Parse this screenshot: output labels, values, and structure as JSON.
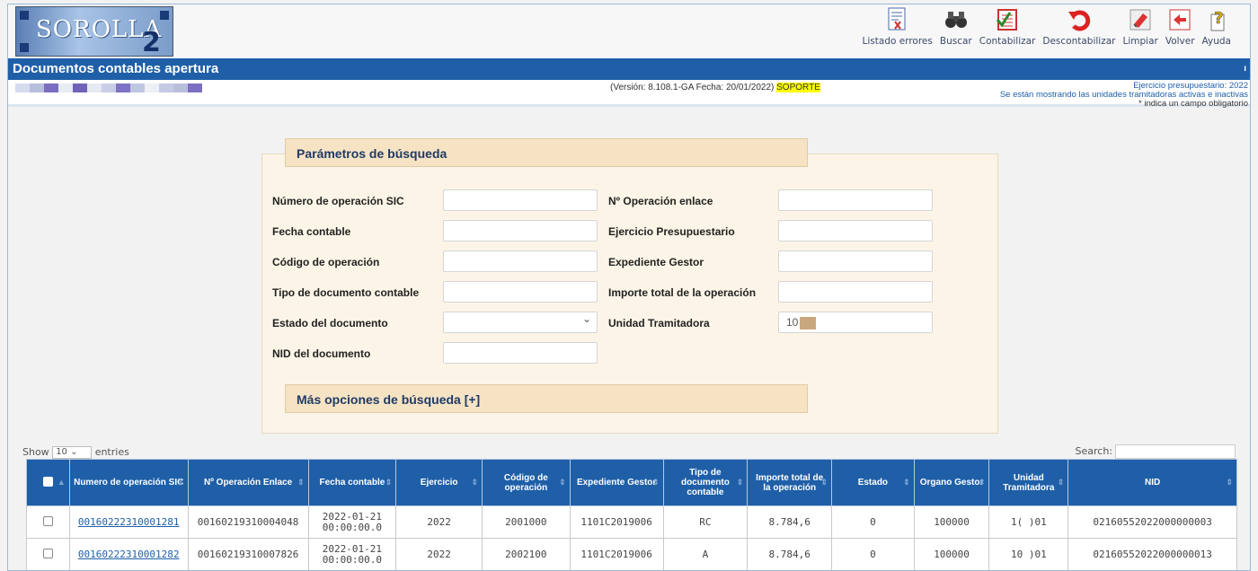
{
  "app": {
    "logo_text": "SOROLLA",
    "logo_suffix": "2"
  },
  "toolbar": [
    {
      "label": "Listado errores",
      "icon": "report-icon"
    },
    {
      "label": "Buscar",
      "icon": "binoculars-icon"
    },
    {
      "label": "Contabilizar",
      "icon": "ledger-check-icon"
    },
    {
      "label": "Descontabilizar",
      "icon": "undo-icon"
    },
    {
      "label": "Limpiar",
      "icon": "eraser-icon"
    },
    {
      "label": "Volver",
      "icon": "back-arrow-icon"
    },
    {
      "label": "Ayuda",
      "icon": "help-icon"
    }
  ],
  "page": {
    "title": "Documentos contables apertura",
    "version_text": "(Versión: 8.108.1-GA Fecha: 20/01/2022)",
    "version_highlight": "SOPORTE",
    "ejercicio": "Ejercicio presupuestario: 2022",
    "units_note": "Se están mostrando las unidades tramitadoras activas e inactivas",
    "required_note": "* indica un campo obligatorio"
  },
  "search": {
    "header": "Parámetros de búsqueda",
    "more_options": "Más opciones de búsqueda [+]",
    "fields": {
      "num_op_sic": {
        "label": "Número de operación SIC",
        "value": ""
      },
      "fecha_contable": {
        "label": "Fecha contable",
        "value": ""
      },
      "codigo_operacion": {
        "label": "Código de operación",
        "value": ""
      },
      "tipo_documento": {
        "label": "Tipo de documento contable",
        "value": ""
      },
      "estado_documento": {
        "label": "Estado del documento",
        "value": ""
      },
      "nid_documento": {
        "label": "NID del documento",
        "value": ""
      },
      "op_enlace": {
        "label": "Nº Operación enlace",
        "value": ""
      },
      "ejercicio_presupuestario": {
        "label": "Ejercicio Presupuestario",
        "value": ""
      },
      "expediente_gestor": {
        "label": "Expediente Gestor",
        "value": ""
      },
      "importe_total": {
        "label": "Importe total de la operación",
        "value": ""
      },
      "unidad_tramitadora": {
        "label": "Unidad Tramitadora",
        "value": "10"
      }
    }
  },
  "table_controls": {
    "show_label": "Show",
    "show_value": "10",
    "entries_label": "entries",
    "search_label": "Search:"
  },
  "table": {
    "columns": [
      "Numero de operación SIC",
      "Nº Operación Enlace",
      "Fecha contable",
      "Ejercicio",
      "Código de operación",
      "Expediente Gestor",
      "Tipo de documento contable",
      "Importe total de la operación",
      "Estado",
      "Organo Gestor",
      "Unidad Tramitadora",
      "NID"
    ],
    "rows": [
      {
        "sic": "00160222310001281",
        "enlace": "00160219310004048",
        "fecha_line1": "2022-01-21",
        "fecha_line2": "00:00:00.0",
        "ejercicio": "2022",
        "codigo": "2001000",
        "expediente": "1101C2019006",
        "tipo": "RC",
        "importe": "8.784,6",
        "estado": "0",
        "organo": "100000",
        "unidad": "1(   )01",
        "nid": "02160552022000000003"
      },
      {
        "sic": "00160222310001282",
        "enlace": "00160219310007826",
        "fecha_line1": "2022-01-21",
        "fecha_line2": "00:00:00.0",
        "ejercicio": "2022",
        "codigo": "2002100",
        "expediente": "1101C2019006",
        "tipo": "A",
        "importe": "8.784,6",
        "estado": "0",
        "organo": "100000",
        "unidad": "10   )01",
        "nid": "02160552022000000013"
      }
    ]
  },
  "colors": {
    "title_bar": "#1f5fa8",
    "panel_bg": "#fcf5e7",
    "panel_header": "#f5e3c4",
    "highlight": "#ffff00"
  }
}
